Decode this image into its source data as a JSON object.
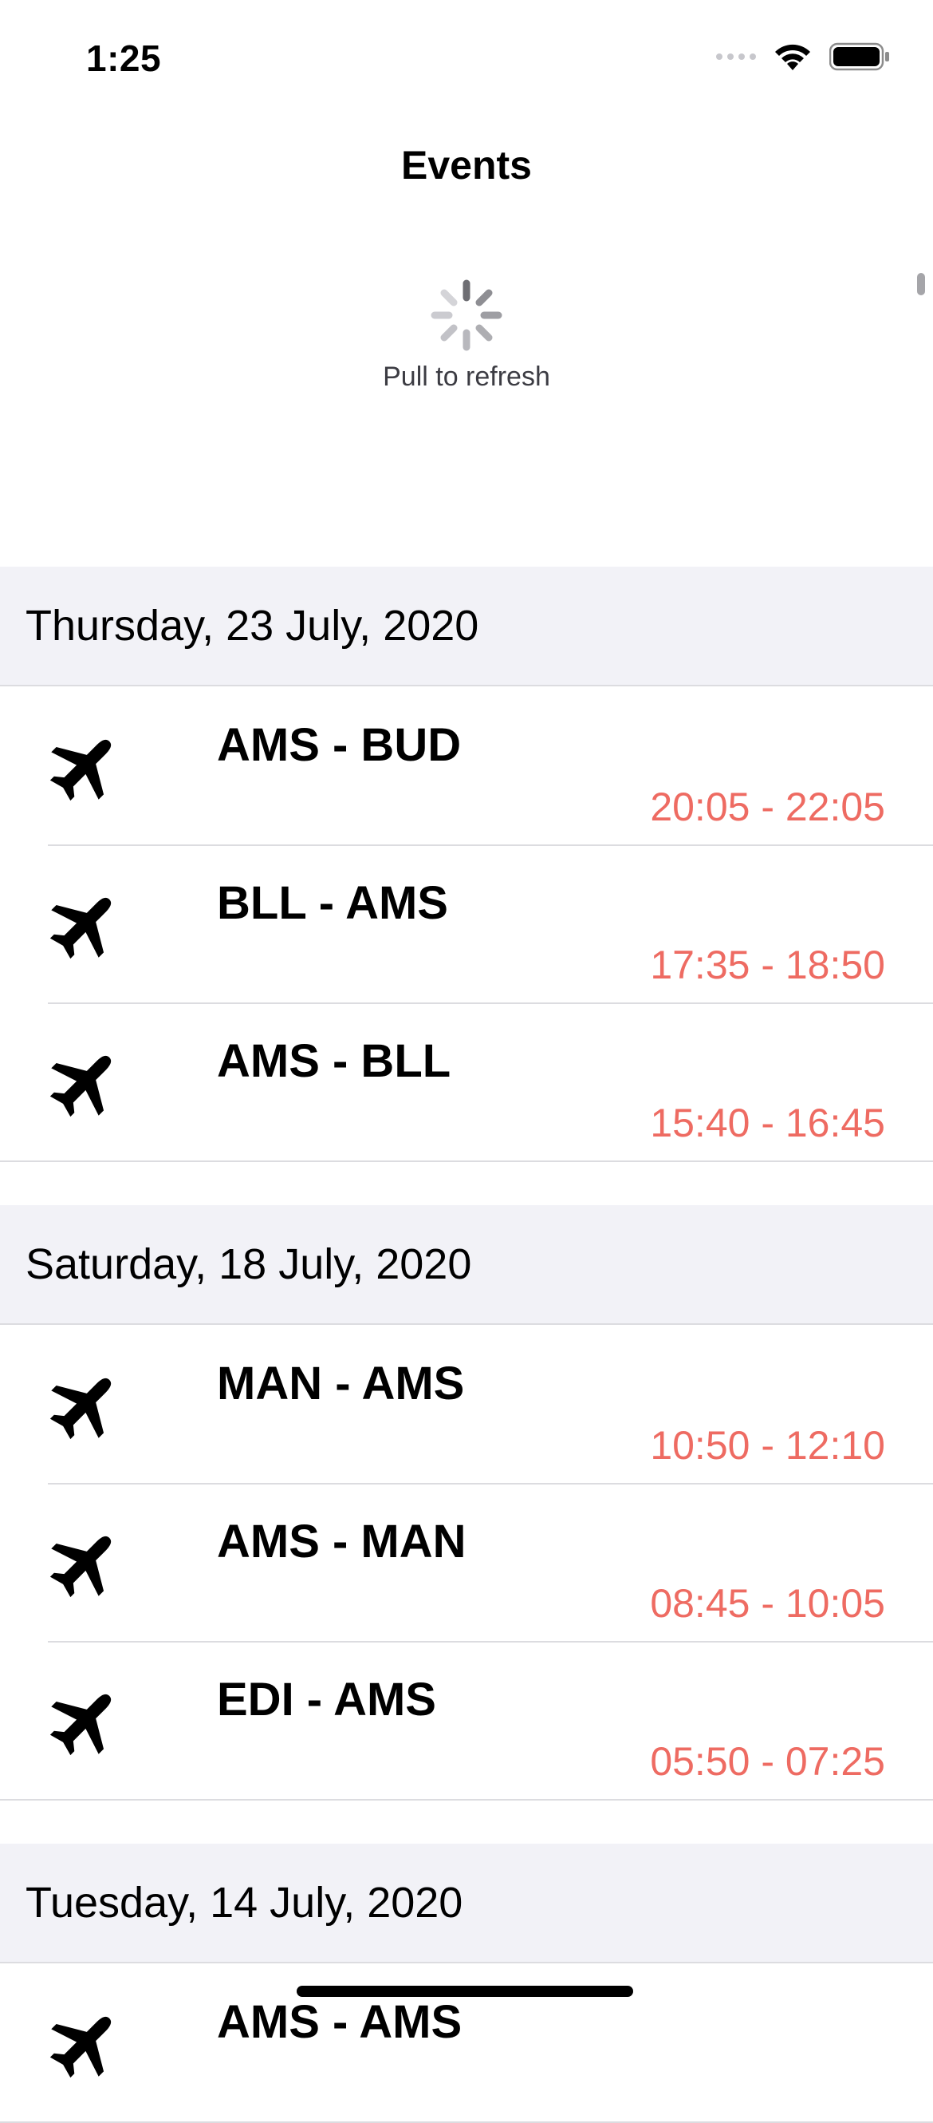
{
  "status_bar": {
    "time": "1:25"
  },
  "nav": {
    "title": "Events"
  },
  "refresh": {
    "label": "Pull to refresh"
  },
  "colors": {
    "time_red": "#ee6b62",
    "section_bg": "#f2f2f7"
  },
  "sections": [
    {
      "date": "Thursday, 23 July, 2020",
      "events": [
        {
          "icon": "airplane-icon",
          "route": "AMS - BUD",
          "times": "20:05 - 22:05"
        },
        {
          "icon": "airplane-icon",
          "route": "BLL - AMS",
          "times": "17:35 - 18:50"
        },
        {
          "icon": "airplane-icon",
          "route": "AMS - BLL",
          "times": "15:40 - 16:45"
        }
      ]
    },
    {
      "date": "Saturday, 18 July, 2020",
      "events": [
        {
          "icon": "airplane-icon",
          "route": "MAN - AMS",
          "times": "10:50 - 12:10"
        },
        {
          "icon": "airplane-icon",
          "route": "AMS - MAN",
          "times": "08:45 - 10:05"
        },
        {
          "icon": "airplane-icon",
          "route": "EDI - AMS",
          "times": "05:50 - 07:25"
        }
      ]
    },
    {
      "date": "Tuesday, 14 July, 2020",
      "events": [
        {
          "icon": "airplane-icon",
          "route": "AMS - AMS",
          "times": ""
        }
      ]
    }
  ]
}
